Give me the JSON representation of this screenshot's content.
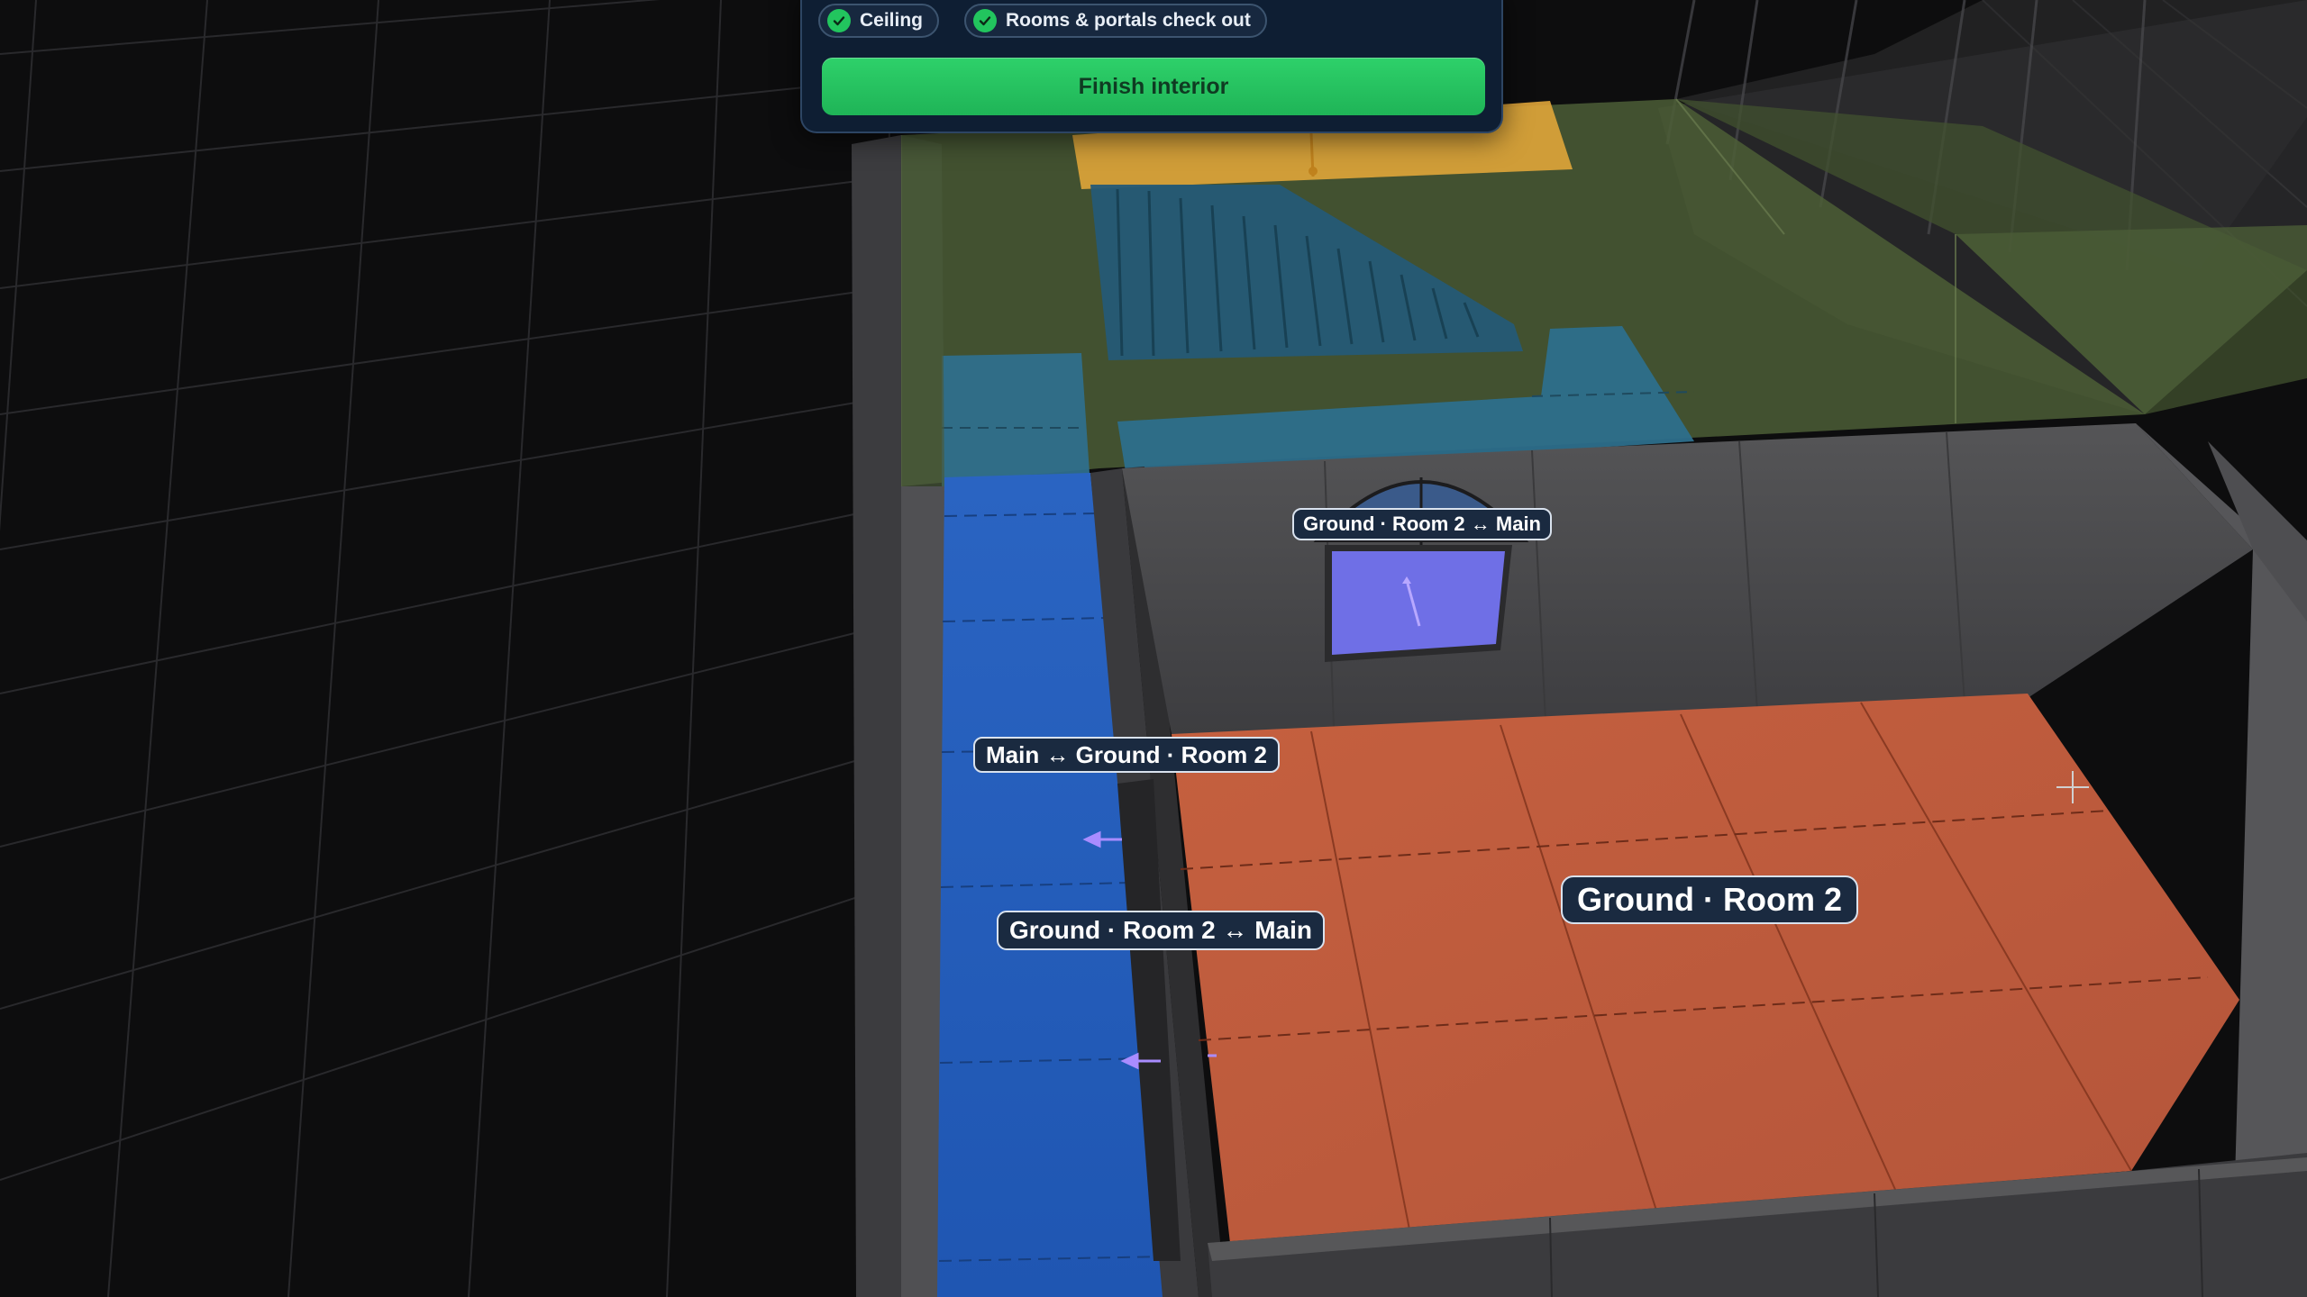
{
  "checklist": {
    "items": [
      {
        "label": "Ceiling",
        "done": true
      },
      {
        "label": "Rooms & portals check out",
        "done": true
      }
    ],
    "finish_button_label": "Finish interior"
  },
  "scene": {
    "portal_labels": {
      "upper_window": "Ground · Room 2 ↔ Main",
      "main_to_ground": "Main ↔ Ground · Room 2",
      "ground_to_main": "Ground · Room 2 ↔ Main"
    },
    "room_label": "Ground · Room 2",
    "colors": {
      "background": "#0d0d0e",
      "grid_line": "#2a2a2d",
      "main_corridor_floor": "#2f6fd0",
      "ground_room2_floor": "#bf5d3f",
      "stair_landing": "#e0a53a",
      "portal_window": "#6f6fe6",
      "upper_room_tint": "#556b3c",
      "wall_gray": "#4a4a4c",
      "accent_green": "#22c55e"
    }
  }
}
